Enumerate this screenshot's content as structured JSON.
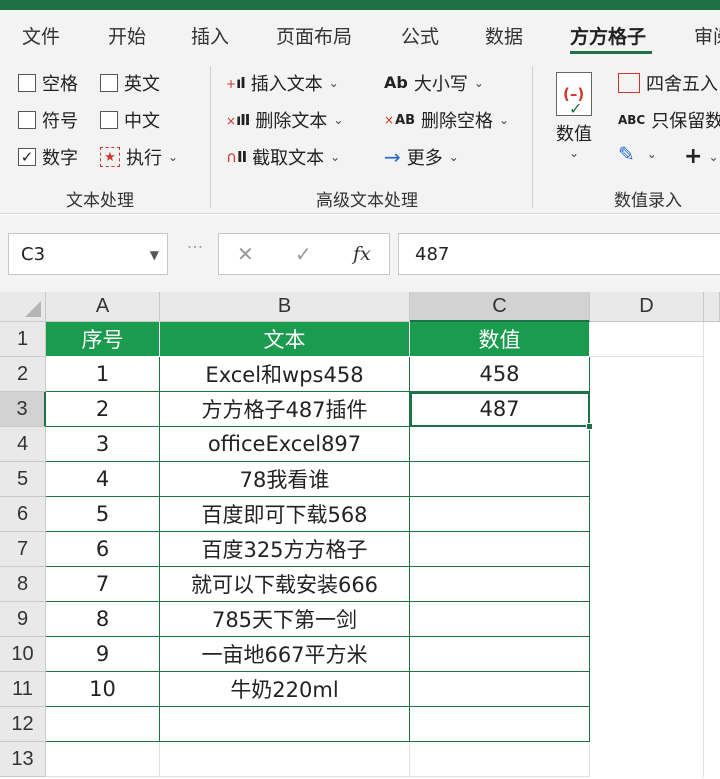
{
  "ribbon": {
    "tabs": [
      "文件",
      "开始",
      "插入",
      "页面布局",
      "公式",
      "数据",
      "方方格子",
      "审阅"
    ],
    "active_tab": "方方格子",
    "text_group": {
      "label": "文本处理",
      "space": "空格",
      "english": "英文",
      "symbol": "符号",
      "chinese": "中文",
      "digit": "数字",
      "execute": "执行",
      "digit_checked": "✓"
    },
    "adv_group": {
      "label": "高级文本处理",
      "insert_text": "插入文本",
      "delete_text": "删除文本",
      "extract_text": "截取文本",
      "case": "大小写",
      "delete_space": "删除空格",
      "more": "更多",
      "case_icon": "Ab",
      "delete_space_icon": "AB",
      "more_icon": "→"
    },
    "num_group": {
      "label": "数值录入",
      "value": "数值",
      "round": "四舍五入",
      "keep_digits": "只保留数",
      "keep_icon": "ABC"
    }
  },
  "formula_bar": {
    "name_box": "C3",
    "value": "487",
    "fx": "fx"
  },
  "sheet": {
    "columns": [
      "A",
      "B",
      "C",
      "D"
    ],
    "rows": [
      "1",
      "2",
      "3",
      "4",
      "5",
      "6",
      "7",
      "8",
      "9",
      "10",
      "11",
      "12",
      "13"
    ],
    "header": [
      "序号",
      "文本",
      "数值"
    ],
    "data": [
      {
        "no": "1",
        "text": "Excel和wps458",
        "value": "458"
      },
      {
        "no": "2",
        "text": "方方格子487插件",
        "value": "487"
      },
      {
        "no": "3",
        "text": "officeExcel897",
        "value": ""
      },
      {
        "no": "4",
        "text": "78我看谁",
        "value": ""
      },
      {
        "no": "5",
        "text": "百度即可下载568",
        "value": ""
      },
      {
        "no": "6",
        "text": "百度325方方格子",
        "value": ""
      },
      {
        "no": "7",
        "text": "就可以下载安装666",
        "value": ""
      },
      {
        "no": "8",
        "text": "785天下第一剑",
        "value": ""
      },
      {
        "no": "9",
        "text": "一亩地667平方米",
        "value": ""
      },
      {
        "no": "10",
        "text": "牛奶220ml",
        "value": ""
      }
    ],
    "selected_cell": "C3"
  }
}
